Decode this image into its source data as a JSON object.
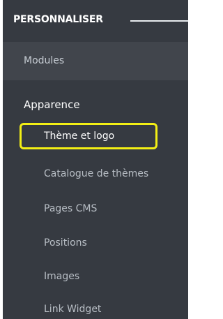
{
  "section": {
    "title": "PERSONNALISER"
  },
  "menu": {
    "modules_label": "Modules",
    "appearance_label": "Apparence",
    "submenu": [
      {
        "label": "Thème et logo",
        "active": true
      },
      {
        "label": "Catalogue de thèmes",
        "active": false
      },
      {
        "label": "Pages CMS",
        "active": false
      },
      {
        "label": "Positions",
        "active": false
      },
      {
        "label": "Images",
        "active": false
      },
      {
        "label": "Link Widget",
        "active": false
      }
    ]
  },
  "colors": {
    "sidebar_bg": "#363a41",
    "modules_bg": "#41454c",
    "highlight": "#f3ef15"
  }
}
